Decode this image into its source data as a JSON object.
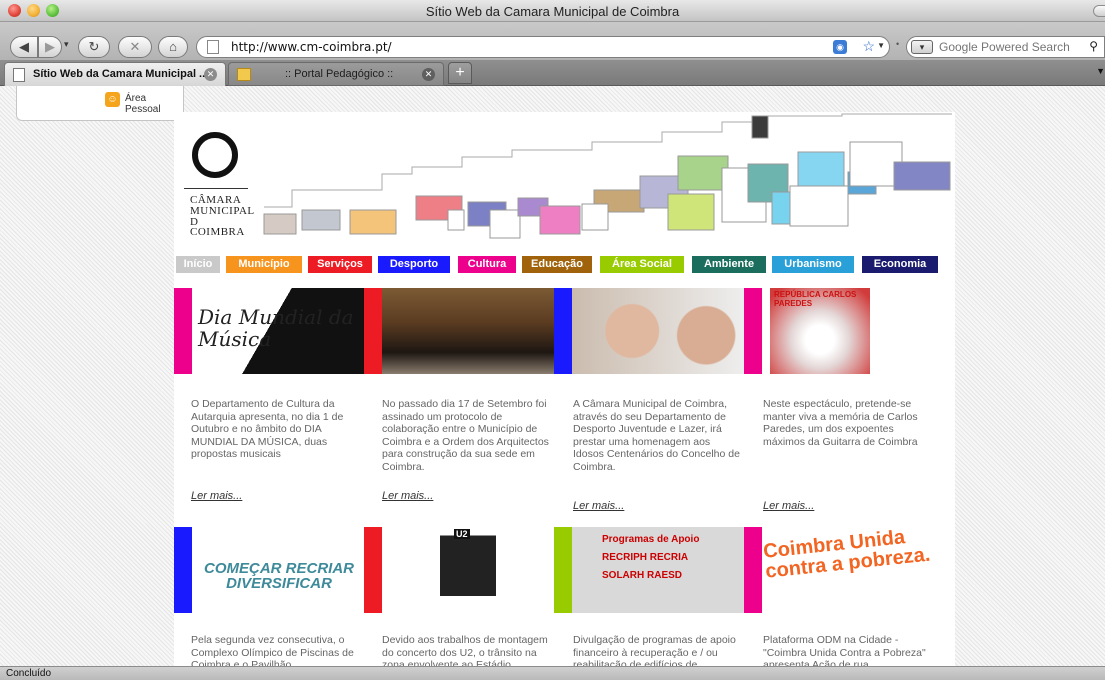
{
  "window": {
    "title": "Sítio Web da Camara Municipal de Coimbra"
  },
  "toolbar": {
    "url": "http://www.cm-coimbra.pt/",
    "search_placeholder": "Google Powered Search"
  },
  "tabs": [
    {
      "label": "Sítio Web da Camara Municipal ...",
      "active": true
    },
    {
      "label": ":: Portal Pedagógico ::",
      "active": false
    }
  ],
  "personal": {
    "label": "Área Pessoal"
  },
  "logo": {
    "line1": "CÂMARA",
    "line2": "MUNICIPAL",
    "line3": "D",
    "line4": "COIMBRA"
  },
  "nav": [
    {
      "label": "Início",
      "color": "#c9c9c9"
    },
    {
      "label": "Município",
      "color": "#f7941d"
    },
    {
      "label": "Serviços",
      "color": "#ed1c24"
    },
    {
      "label": "Desporto",
      "color": "#1a1aff"
    },
    {
      "label": "Cultura",
      "color": "#ec008c"
    },
    {
      "label": "Educação",
      "color": "#a0620a"
    },
    {
      "label": "Área Social",
      "color": "#99cc00"
    },
    {
      "label": "Ambiente",
      "color": "#1b6e5e"
    },
    {
      "label": "Urbanismo",
      "color": "#2aa0d8"
    },
    {
      "label": "Economia",
      "color": "#1a1a6e"
    }
  ],
  "stories_row1": [
    {
      "bar_color": "#ec008c",
      "image_caption": "Dia Mundial da Música",
      "text": "O Departamento de Cultura da Autarquia apresenta, no dia 1 de Outubro e no âmbito do DIA MUNDIAL DA MÚSICA, duas propostas musicais",
      "more": "Ler mais..."
    },
    {
      "bar_color": "#ed1c24",
      "image_caption": "",
      "text": "No passado dia 17 de Setembro foi assinado um protocolo de colaboração entre o Município de Coimbra e a Ordem dos Arquitectos para construção da sua sede em Coimbra.",
      "more": "Ler mais..."
    },
    {
      "bar_color": "#1a1aff",
      "image_caption": "",
      "text": "A Câmara Municipal de Coimbra, através do seu Departamento de Desporto Juventude e Lazer, irá prestar uma homenagem aos Idosos Centenários do Concelho de Coimbra.",
      "more": "Ler mais..."
    },
    {
      "bar_color": "#ec008c",
      "image_caption": "REPÚBLICA CARLOS PAREDES",
      "text": "Neste espectáculo, pretende-se manter viva a memória de Carlos Paredes, um dos expoentes máximos da Guitarra de Coimbra",
      "more": "Ler mais..."
    }
  ],
  "stories_row2": [
    {
      "bar_color": "#1a1aff",
      "image_caption": "COMEÇAR RECRIAR DIVERSIFICAR",
      "text": "Pela segunda vez consecutiva, o Complexo Olímpico de Piscinas de Coimbra e o Pavilhão Multidesportos"
    },
    {
      "bar_color": "#ed1c24",
      "image_caption": "U2",
      "text": "Devido aos trabalhos de montagem do concerto dos U2, o trânsito na zona envolvente ao Estádio"
    },
    {
      "bar_color": "#99cc00",
      "image_caption": "Programas de Apoio RECRIPH RECRIA SOLARH RAESD",
      "text": "Divulgação de programas de apoio financeiro à recuperação e / ou reabilitação de edifícios de habitação"
    },
    {
      "bar_color": "#ec008c",
      "image_caption": "Coimbra Unida contra a pobreza.",
      "text": "Plataforma ODM na Cidade - \"Coimbra Unida Contra a Pobreza\" apresenta Ação de rua"
    }
  ],
  "status": {
    "text": "Concluído"
  }
}
